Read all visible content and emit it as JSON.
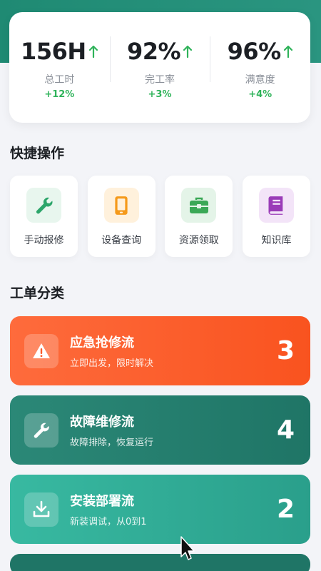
{
  "stats": [
    {
      "value": "156H",
      "label": "总工时",
      "change": "+12%"
    },
    {
      "value": "92%",
      "label": "完工率",
      "change": "+3%"
    },
    {
      "value": "96%",
      "label": "满意度",
      "change": "+4%"
    }
  ],
  "quick_actions": {
    "title": "快捷操作",
    "items": [
      {
        "label": "手动报修",
        "icon": "wrench-icon",
        "color": "#2ca56a",
        "bg": "#e8f6ee"
      },
      {
        "label": "设备查询",
        "icon": "phone-icon",
        "color": "#f59a1b",
        "bg": "#fff1dc"
      },
      {
        "label": "资源领取",
        "icon": "toolbox-icon",
        "color": "#3aa856",
        "bg": "#e4f4e8"
      },
      {
        "label": "知识库",
        "icon": "book-icon",
        "color": "#9a3cb8",
        "bg": "#f3e4f8"
      }
    ]
  },
  "work_orders": {
    "title": "工单分类",
    "items": [
      {
        "title": "应急抢修流",
        "subtitle": "立即出发，限时解决",
        "count": "3",
        "icon": "warning-icon",
        "color": "#fb5b2a"
      },
      {
        "title": "故障维修流",
        "subtitle": "故障排除，恢复运行",
        "count": "4",
        "icon": "wrench-icon",
        "color": "#237e6d"
      },
      {
        "title": "安装部署流",
        "subtitle": "新装调试，从0到1",
        "count": "2",
        "icon": "download-icon",
        "color": "#2fae97"
      }
    ]
  },
  "colors": {
    "header_teal": "#1f8a73",
    "positive_green": "#2fb35a"
  }
}
